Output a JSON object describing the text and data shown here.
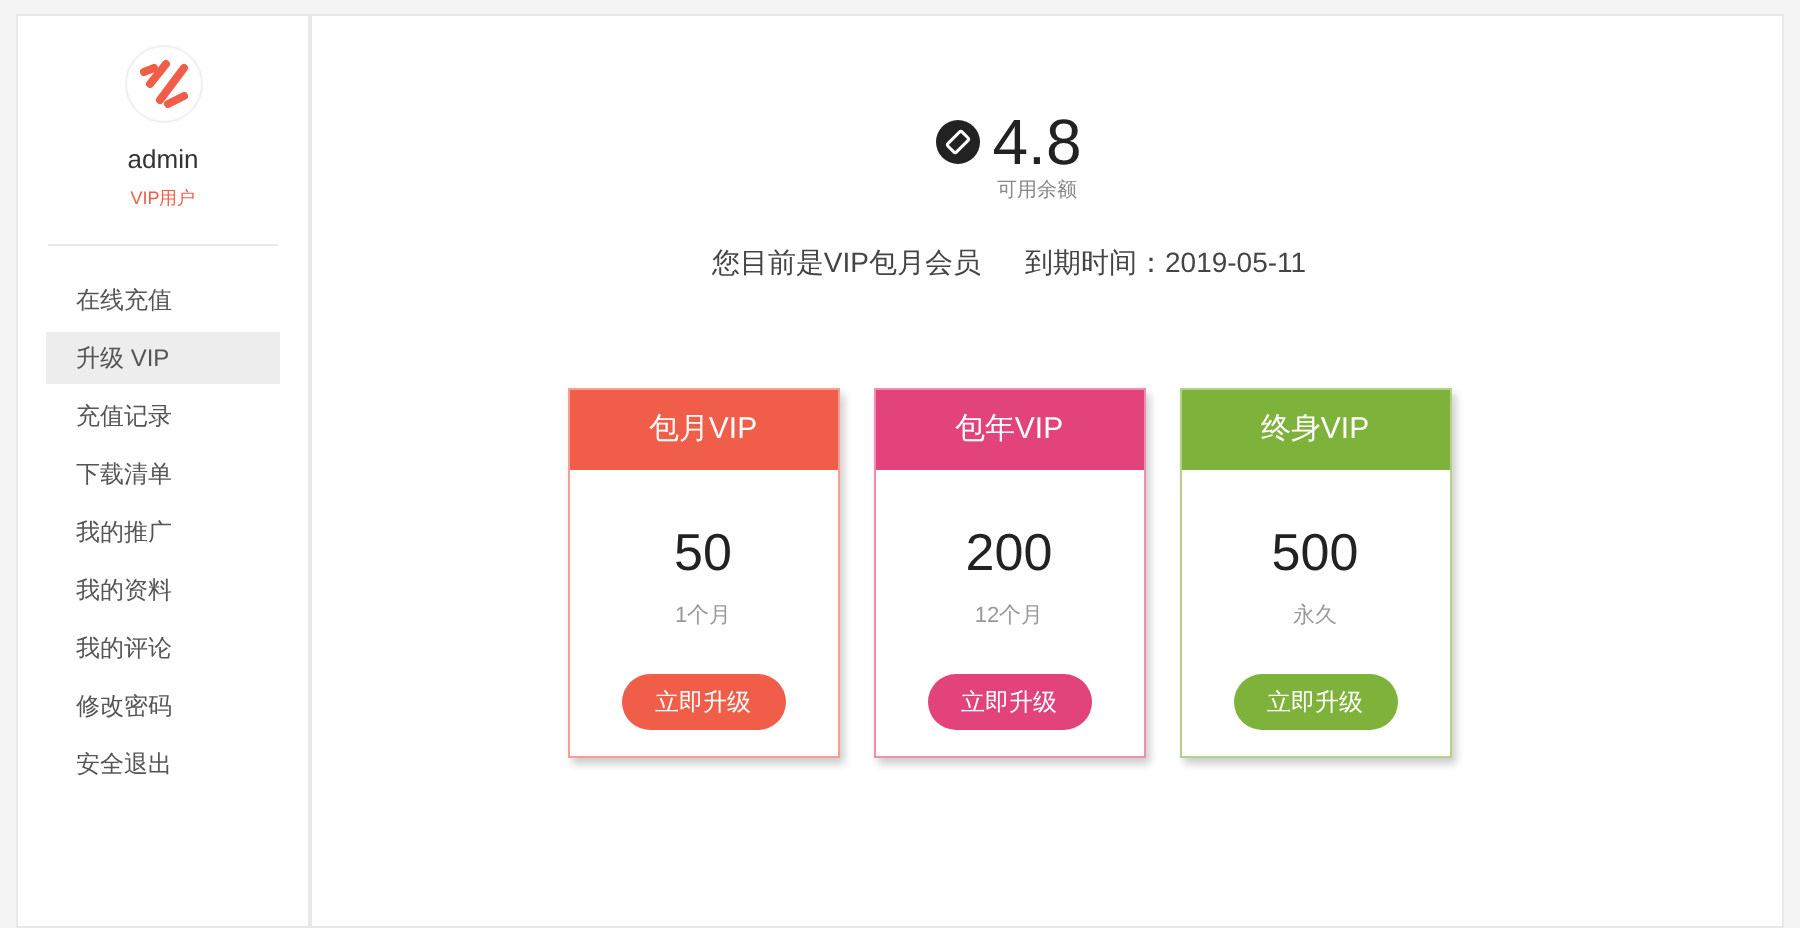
{
  "profile": {
    "username": "admin",
    "role": "VIP用户"
  },
  "sidebar": {
    "items": [
      {
        "label": "在线充值",
        "selected": false
      },
      {
        "label": "升级 VIP",
        "selected": true
      },
      {
        "label": "充值记录",
        "selected": false
      },
      {
        "label": "下载清单",
        "selected": false
      },
      {
        "label": "我的推广",
        "selected": false
      },
      {
        "label": "我的资料",
        "selected": false
      },
      {
        "label": "我的评论",
        "selected": false
      },
      {
        "label": "修改密码",
        "selected": false
      },
      {
        "label": "安全退出",
        "selected": false
      }
    ]
  },
  "balance": {
    "amount": "4.8",
    "label": "可用余额"
  },
  "membership": {
    "status": "您目前是VIP包月会员",
    "expiry": "到期时间：2019-05-11"
  },
  "plans": [
    {
      "name": "包月VIP",
      "price": "50",
      "period": "1个月",
      "button": "立即升级",
      "color": "#f05d49"
    },
    {
      "name": "包年VIP",
      "price": "200",
      "period": "12个月",
      "button": "立即升级",
      "color": "#e2437b"
    },
    {
      "name": "终身VIP",
      "price": "500",
      "period": "永久",
      "button": "立即升级",
      "color": "#7fb23b"
    }
  ]
}
